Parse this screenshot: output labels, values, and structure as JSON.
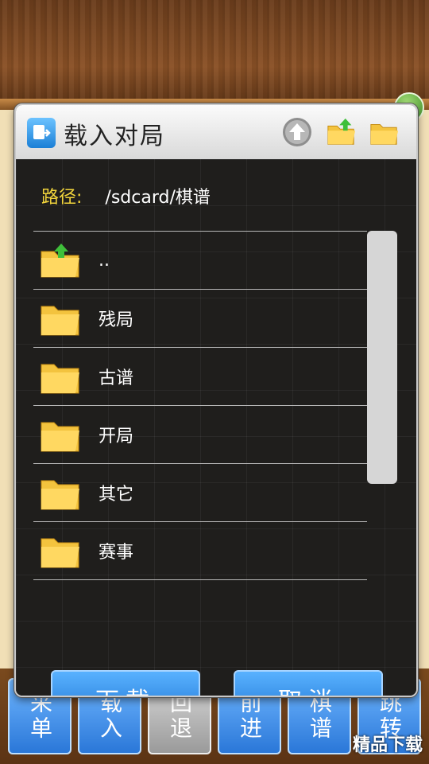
{
  "dialog": {
    "title": "载入对局",
    "path_label": "路径:",
    "path_value": "/sdcard/棋谱"
  },
  "entries": [
    {
      "name": "..",
      "icon": "folder-up-icon"
    },
    {
      "name": "残局",
      "icon": "folder-icon"
    },
    {
      "name": "古谱",
      "icon": "folder-icon"
    },
    {
      "name": "开局",
      "icon": "folder-icon"
    },
    {
      "name": "其它",
      "icon": "folder-icon"
    },
    {
      "name": "赛事",
      "icon": "folder-icon"
    }
  ],
  "buttons": {
    "download": "下载",
    "cancel": "取消"
  },
  "bottom_bar": [
    {
      "label": "采单"
    },
    {
      "label": "载入"
    },
    {
      "label": "回退"
    },
    {
      "label": "前进"
    },
    {
      "label": "棋谱"
    },
    {
      "label": "跳转"
    }
  ],
  "watermark": "精品下载",
  "colors": {
    "accent_blue": "#2a77d8",
    "path_label_yellow": "#f2d53c"
  }
}
